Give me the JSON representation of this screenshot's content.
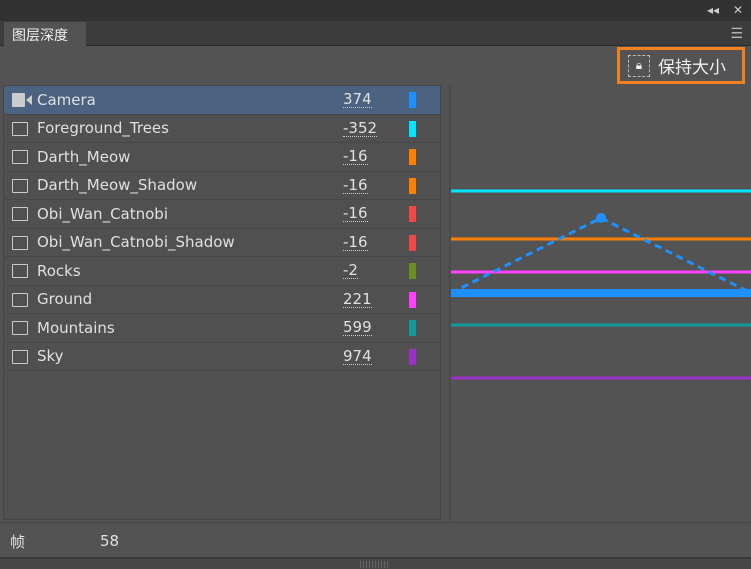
{
  "window": {
    "collapse_icon": "double-chevron-left",
    "close_icon": "close"
  },
  "tab": {
    "label": "图层深度"
  },
  "toolbar": {
    "keep_size_label": "保持大小"
  },
  "layers": [
    {
      "name": "Camera",
      "value": "374",
      "color": "#1e90ff",
      "type": "camera",
      "selected": true
    },
    {
      "name": "Foreground_Trees",
      "value": "-352",
      "color": "#00e5ff",
      "type": "layer"
    },
    {
      "name": "Darth_Meow",
      "value": "-16",
      "color": "#ff8000",
      "type": "layer"
    },
    {
      "name": "Darth_Meow_Shadow",
      "value": "-16",
      "color": "#ff8000",
      "type": "layer"
    },
    {
      "name": "Obi_Wan_Catnobi",
      "value": "-16",
      "color": "#f04848",
      "type": "layer"
    },
    {
      "name": "Obi_Wan_Catnobi_Shadow",
      "value": "-16",
      "color": "#f04848",
      "type": "layer"
    },
    {
      "name": "Rocks",
      "value": "-2",
      "color": "#6b8e23",
      "type": "layer"
    },
    {
      "name": "Ground",
      "value": "221",
      "color": "#ff40ff",
      "type": "layer"
    },
    {
      "name": "Mountains",
      "value": "599",
      "color": "#119a9a",
      "type": "layer"
    },
    {
      "name": "Sky",
      "value": "974",
      "color": "#9a30c8",
      "type": "layer"
    }
  ],
  "footer": {
    "frame_label": "帧",
    "frame_value": "58"
  }
}
